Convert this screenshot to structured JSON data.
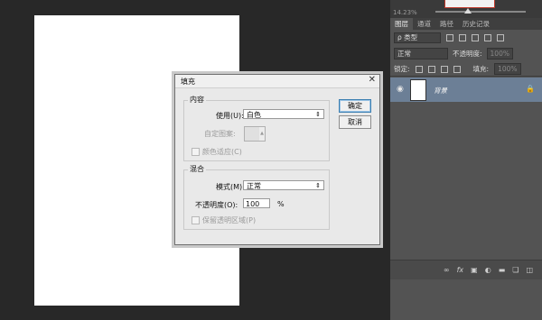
{
  "navigator": {
    "zoom": "14.23%"
  },
  "panel_tabs": [
    "图层",
    "通道",
    "路径",
    "历史记录"
  ],
  "layers_panel": {
    "kind_label": "ρ 类型",
    "blend_mode": "正常",
    "opacity_label": "不透明度:",
    "opacity_value": "100%",
    "lock_label": "锁定:",
    "fill_label": "填充:",
    "fill_value": "100%",
    "layer_name": "背景"
  },
  "dialog": {
    "title": "填充",
    "close": "✕",
    "content_group": "内容",
    "use_label": "使用(U):",
    "use_value": "白色",
    "pattern_label": "自定图案:",
    "color_adapt_label": "颜色适应(C)",
    "blend_group": "混合",
    "mode_label": "模式(M):",
    "mode_value": "正常",
    "opacity_label": "不透明度(O):",
    "opacity_value": "100",
    "percent": "%",
    "preserve_label": "保留透明区域(P)",
    "ok_label": "确定",
    "cancel_label": "取消"
  }
}
